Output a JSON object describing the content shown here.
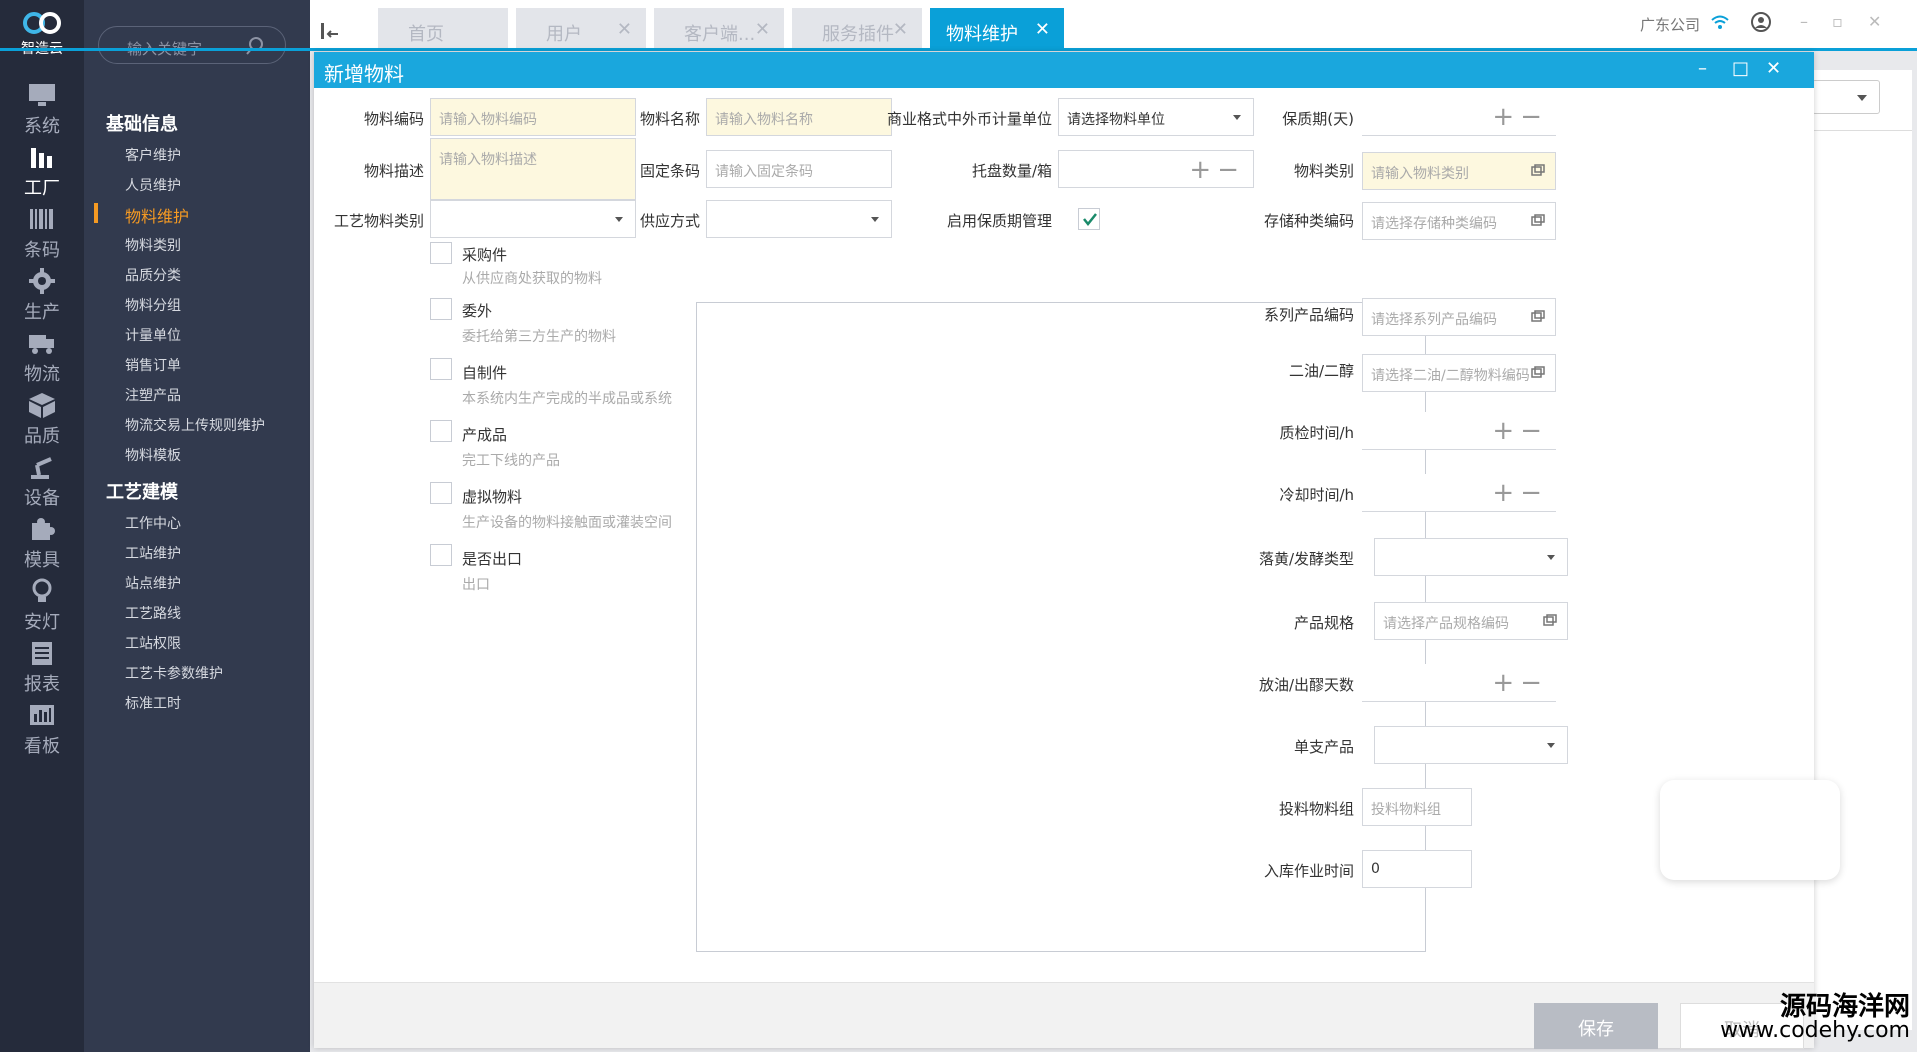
{
  "logo": {
    "name": "智造云"
  },
  "rail": [
    {
      "label": "系统",
      "icon": "monitor-icon"
    },
    {
      "label": "工厂",
      "icon": "factory-icon"
    },
    {
      "label": "条码",
      "icon": "barcode-icon"
    },
    {
      "label": "生产",
      "icon": "gear-icon"
    },
    {
      "label": "物流",
      "icon": "truck-icon"
    },
    {
      "label": "品质",
      "icon": "box-icon"
    },
    {
      "label": "设备",
      "icon": "robot-arm-icon"
    },
    {
      "label": "模具",
      "icon": "puzzle-icon"
    },
    {
      "label": "安灯",
      "icon": "bulb-icon"
    },
    {
      "label": "报表",
      "icon": "report-icon"
    },
    {
      "label": "看板",
      "icon": "chart-icon"
    }
  ],
  "search": {
    "placeholder": "输入关键字"
  },
  "menu": {
    "section1": "基础信息",
    "items1": [
      "客户维护",
      "人员维护",
      "物料维护",
      "物料类别",
      "品质分类",
      "物料分组",
      "计量单位",
      "销售订单",
      "注塑产品",
      "物流交易上传规则维护",
      "物料模板"
    ],
    "section2": "工艺建模",
    "items2": [
      "工作中心",
      "工站维护",
      "站点维护",
      "工艺路线",
      "工站权限",
      "工艺卡参数维护",
      "标准工时"
    ]
  },
  "tabs": [
    "首页",
    "用户",
    "客户端...",
    "服务插件",
    "物料维护"
  ],
  "company": "广东公司",
  "modal": {
    "title": "新增物料",
    "labels": {
      "code": "物料编码",
      "name": "物料名称",
      "unit": "商业格式中外币计量单位",
      "shelf": "保质期(天)",
      "desc": "物料描述",
      "fixed": "固定条码",
      "pallet": "托盘数量/箱",
      "category": "物料类别",
      "process": "工艺物料类别",
      "supply": "供应方式",
      "enable": "启用保质期管理",
      "storage": "存储种类编码",
      "series": "系列产品编码",
      "oil": "二油/二醇",
      "qc": "质检时间/h",
      "cool": "冷却时间/h",
      "drop": "落黄/发酵类型",
      "spec": "产品规格",
      "days": "放油/出醪天数",
      "single": "单支产品",
      "feed": "投料物料组",
      "inbound": "入库作业时间"
    },
    "placeholders": {
      "code": "请输入物料编码",
      "name": "请输入物料名称",
      "unit": "请选择物料单位",
      "desc": "请输入物料描述",
      "fixed": "请输入固定条码",
      "category": "请输入物料类别",
      "storage": "请选择存储种类编码",
      "series": "请选择系列产品编码",
      "oil": "请选择二油/二醇物料编码",
      "spec": "请选择产品规格编码",
      "feed": "投料物料组"
    },
    "inbound_value": "0",
    "checks": [
      {
        "label": "采购件",
        "desc": "从供应商处获取的物料"
      },
      {
        "label": "委外",
        "desc": "委托给第三方生产的物料"
      },
      {
        "label": "自制件",
        "desc": "本系统内生产完成的半成品或系统"
      },
      {
        "label": "产成品",
        "desc": "完工下线的产品"
      },
      {
        "label": "虚拟物料",
        "desc": "生产设备的物料接触面或灌装空间"
      },
      {
        "label": "是否出口",
        "desc": "出口"
      }
    ],
    "save": "保存",
    "cancel": "取消"
  },
  "watermark": {
    "line1": "源码海洋网",
    "line2": "www.codehy.com"
  },
  "colors": {
    "accent": "#1aa7dd",
    "menu_active": "#f59a23",
    "rail_bg": "#252b3b",
    "submenu_bg": "#323a4e",
    "required_bg": "#fdf8df"
  }
}
